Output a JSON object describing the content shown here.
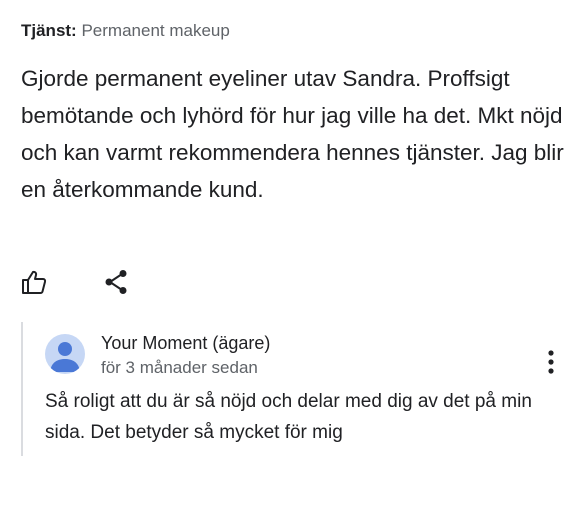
{
  "service": {
    "label": "Tjänst:",
    "value": "Permanent makeup"
  },
  "review": {
    "text": "Gjorde permanent eyeliner utav Sandra. Proffsigt bemötande och lyhörd för hur jag ville ha det. Mkt nöjd och kan varmt rekommendera hennes tjänster. Jag blir en återkommande kund."
  },
  "actions": {
    "like_icon": "thumbs-up-icon",
    "share_icon": "share-icon"
  },
  "reply": {
    "owner_name": "Your Moment (ägare)",
    "time": "för 3 månader sedan",
    "text": "Så roligt att du är så nöjd och delar med dig av det på min sida. Det betyder så mycket för mig",
    "avatar_icon": "person-avatar-icon",
    "menu_icon": "more-vertical-icon"
  },
  "colors": {
    "text": "#202124",
    "secondary_text": "#5f6368",
    "divider": "#dadce0",
    "avatar_bg": "#c6d7f5",
    "avatar_fg": "#4a78d6"
  }
}
